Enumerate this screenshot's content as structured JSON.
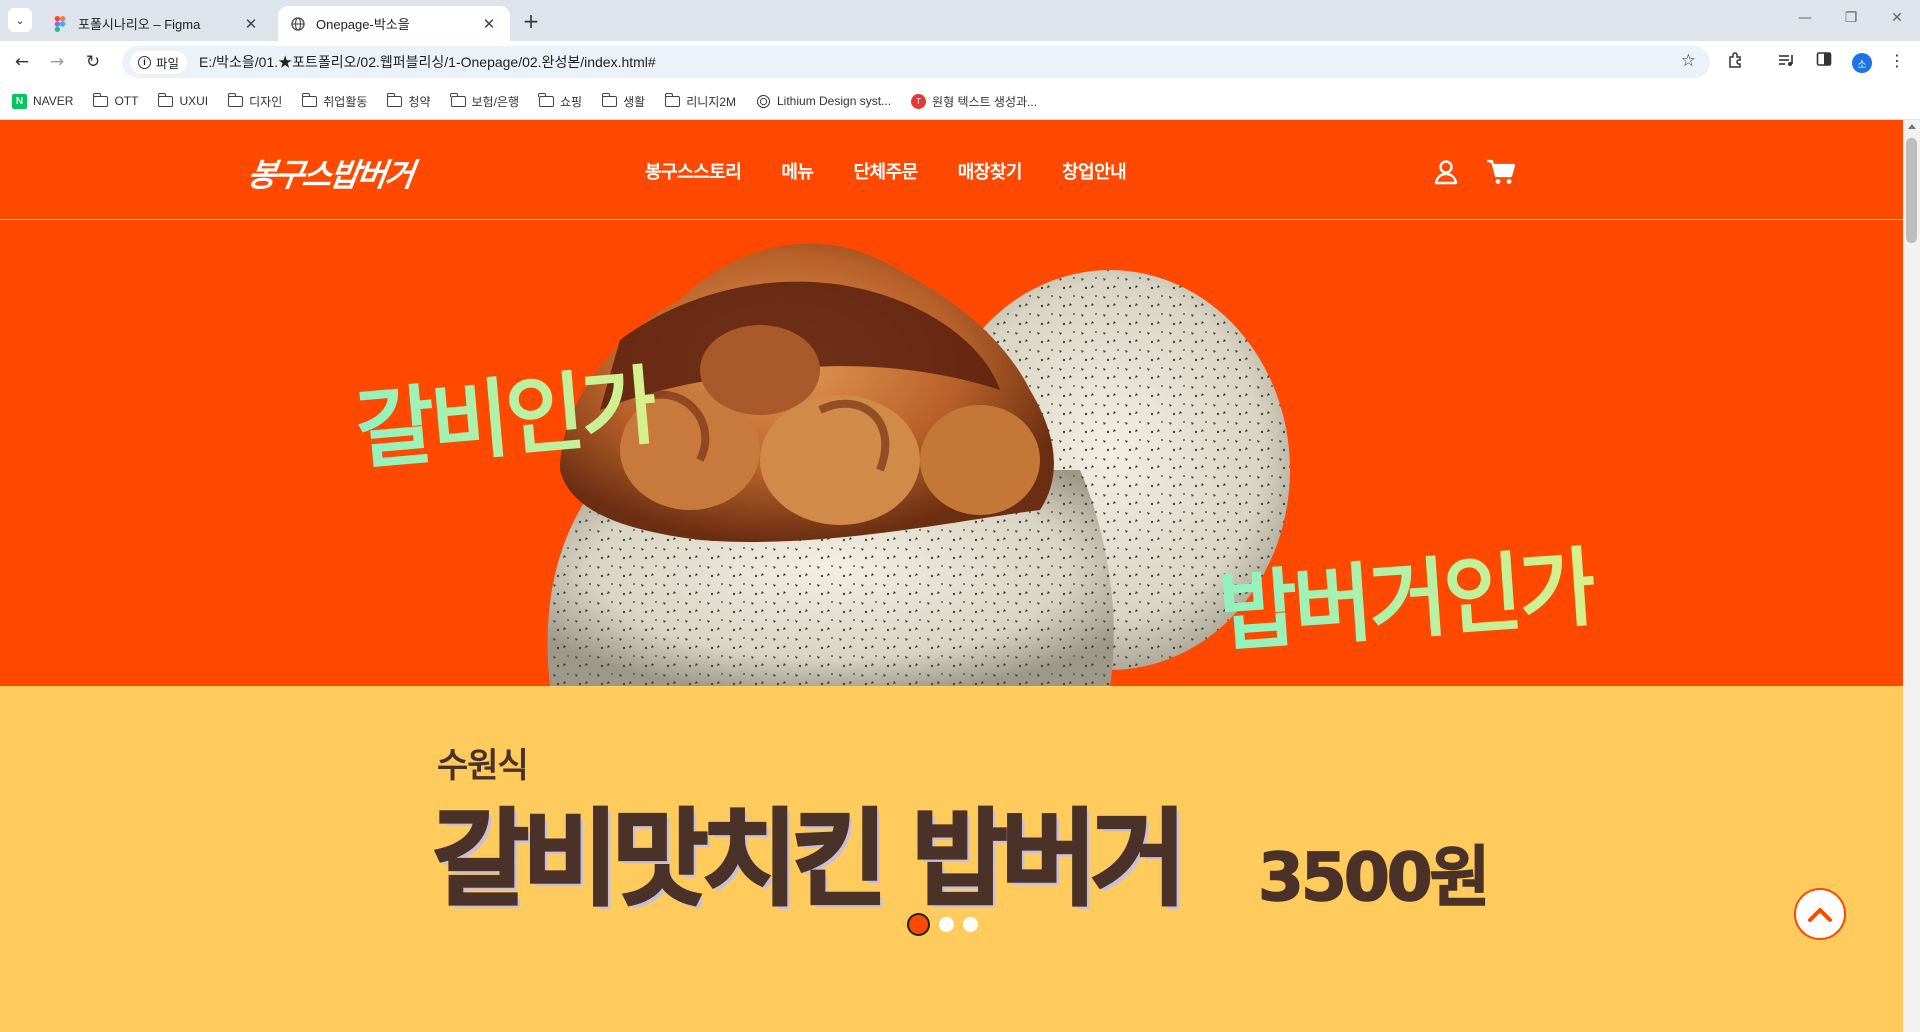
{
  "browser": {
    "tabs": [
      {
        "title": "포폴시나리오 – Figma",
        "icon": "figma-icon",
        "active": false
      },
      {
        "title": "Onepage-박소을",
        "icon": "globe-icon",
        "active": true
      }
    ],
    "address": {
      "scheme_chip": "파일",
      "url": "E:/박소을/01.★포트폴리오/02.웹퍼블리싱/1-Onepage/02.완성본/index.html#"
    },
    "bookmarks": [
      {
        "label": "NAVER",
        "icon": "naver-icon"
      },
      {
        "label": "OTT",
        "icon": "folder-icon"
      },
      {
        "label": "UXUI",
        "icon": "folder-icon"
      },
      {
        "label": "디자인",
        "icon": "folder-icon"
      },
      {
        "label": "취업활동",
        "icon": "folder-icon"
      },
      {
        "label": "청약",
        "icon": "folder-icon"
      },
      {
        "label": "보험/은행",
        "icon": "folder-icon"
      },
      {
        "label": "쇼핑",
        "icon": "folder-icon"
      },
      {
        "label": "생활",
        "icon": "folder-icon"
      },
      {
        "label": "리니지2M",
        "icon": "folder-icon"
      },
      {
        "label": "Lithium Design syst...",
        "icon": "globe-icon"
      },
      {
        "label": "원형 텍스트 생성과...",
        "icon": "circle-text-icon"
      }
    ],
    "profile_initial": "소"
  },
  "site": {
    "logo": "봉구스밥버거",
    "nav": [
      "봉구스스토리",
      "메뉴",
      "단체주문",
      "매장찾기",
      "창업안내"
    ],
    "hero": {
      "text_left": "갈비인가",
      "text_right": "밥버거인가"
    },
    "promo": {
      "subtitle": "수원식",
      "title": "갈비맛치킨 밥버거",
      "price": "3500원",
      "slides_total": 3,
      "active_slide": 1
    },
    "colors": {
      "brand_orange": "#ff4800",
      "promo_yellow": "#ffcb5c",
      "promo_text": "#4a3228",
      "hero_text_gradient": [
        "#8ff2c0",
        "#d8f08a"
      ]
    }
  }
}
